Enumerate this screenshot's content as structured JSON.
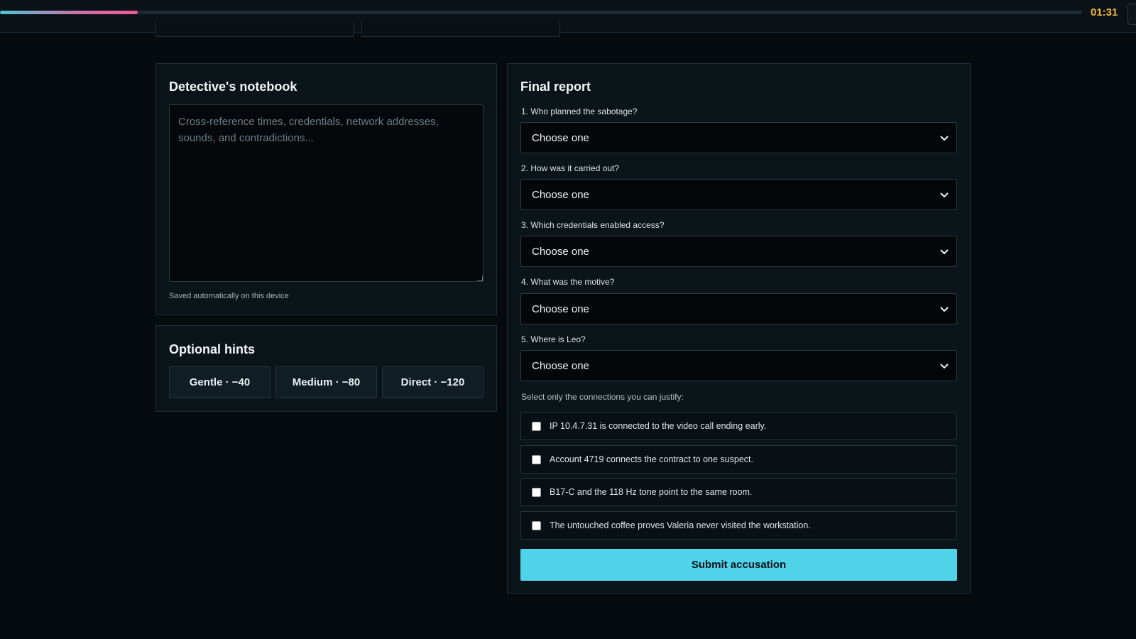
{
  "topbar": {
    "timer": "01:31",
    "progress_fraction": 0.127
  },
  "notebook": {
    "title": "Detective's notebook",
    "placeholder": "Cross-reference times, credentials, network addresses, sounds, and contradictions...",
    "saved_note": "Saved automatically on this device"
  },
  "hints": {
    "title": "Optional hints",
    "buttons": [
      "Gentle · −40",
      "Medium · −80",
      "Direct · −120"
    ]
  },
  "report": {
    "title": "Final report",
    "questions": [
      {
        "label": "1. Who planned the sabotage?",
        "value": "Choose one"
      },
      {
        "label": "2. How was it carried out?",
        "value": "Choose one"
      },
      {
        "label": "3. Which credentials enabled access?",
        "value": "Choose one"
      },
      {
        "label": "4. What was the motive?",
        "value": "Choose one"
      },
      {
        "label": "5. Where is Leo?",
        "value": "Choose one"
      }
    ],
    "justify_label": "Select only the connections you can justify:",
    "connections": [
      "IP 10.4.7.31 is connected to the video call ending early.",
      "Account 4719 connects the contract to one suspect.",
      "B17-C and the 118 Hz tone point to the same room.",
      "The untouched coffee proves Valeria never visited the workstation."
    ],
    "submit_label": "Submit accusation"
  }
}
